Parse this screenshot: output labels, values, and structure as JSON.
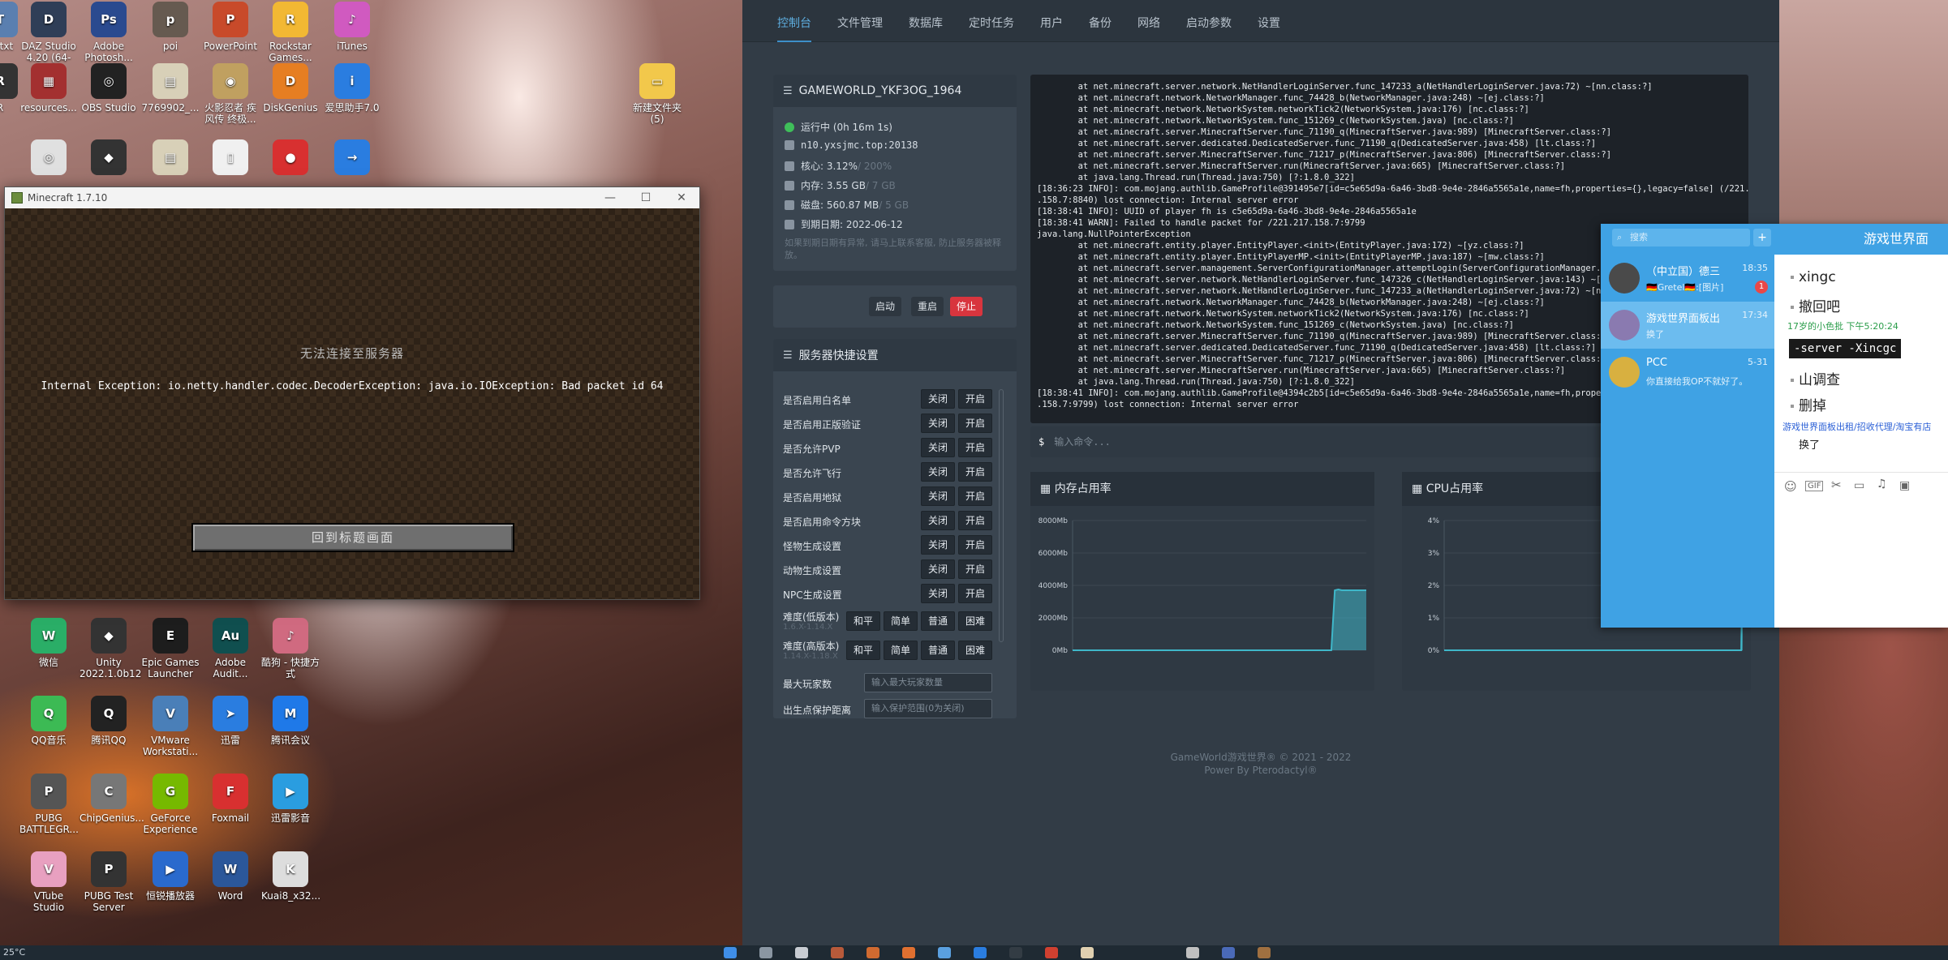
{
  "desktop": {
    "icons": [
      {
        "label": "文\ntxt",
        "x": -36,
        "y": 2,
        "color": "#5a7fb0",
        "glyph": "T"
      },
      {
        "label": "DAZ Studio 4.20 (64-bit)",
        "x": 24,
        "y": 2,
        "color": "#2f3e57",
        "glyph": "D"
      },
      {
        "label": "Adobe Photosh...",
        "x": 98,
        "y": 2,
        "color": "#2a4a8f",
        "glyph": "Ps"
      },
      {
        "label": "poi",
        "x": 174,
        "y": 2,
        "color": "#665a50",
        "glyph": "p"
      },
      {
        "label": "PowerPoint",
        "x": 248,
        "y": 2,
        "color": "#c84a2a",
        "glyph": "P"
      },
      {
        "label": "Rockstar Games...",
        "x": 322,
        "y": 2,
        "color": "#f2b833",
        "glyph": "R"
      },
      {
        "label": "iTunes",
        "x": 398,
        "y": 2,
        "color": "#d05ac0",
        "glyph": "♪"
      },
      {
        "label": "R",
        "x": -36,
        "y": 78,
        "color": "#333",
        "glyph": "R"
      },
      {
        "label": "resources...",
        "x": 24,
        "y": 78,
        "color": "#a33030",
        "glyph": "▦"
      },
      {
        "label": "OBS Studio",
        "x": 98,
        "y": 78,
        "color": "#222",
        "glyph": "◎"
      },
      {
        "label": "7769902_...",
        "x": 174,
        "y": 78,
        "color": "#d8d0b8",
        "glyph": "▤"
      },
      {
        "label": "火影忍者 疾风传 终极...",
        "x": 248,
        "y": 78,
        "color": "#c0a060",
        "glyph": "◉"
      },
      {
        "label": "DiskGenius",
        "x": 322,
        "y": 78,
        "color": "#e67e22",
        "glyph": "D"
      },
      {
        "label": "爱思助手7.0",
        "x": 398,
        "y": 78,
        "color": "#2a7de0",
        "glyph": "i"
      },
      {
        "label": "新建文件夹 (5)",
        "x": 774,
        "y": 78,
        "color": "#f2c84b",
        "glyph": "▭"
      },
      {
        "label": "",
        "x": 24,
        "y": 172,
        "color": "#e0e0e0",
        "glyph": "◎"
      },
      {
        "label": "",
        "x": 98,
        "y": 172,
        "color": "#333",
        "glyph": "◆"
      },
      {
        "label": "",
        "x": 174,
        "y": 172,
        "color": "#d8d0b8",
        "glyph": "▤"
      },
      {
        "label": "",
        "x": 248,
        "y": 172,
        "color": "#f0f0f0",
        "glyph": "▯"
      },
      {
        "label": "",
        "x": 322,
        "y": 172,
        "color": "#d83030",
        "glyph": "●"
      },
      {
        "label": "",
        "x": 398,
        "y": 172,
        "color": "#2a7de0",
        "glyph": "→"
      },
      {
        "label": "微信",
        "x": 24,
        "y": 762,
        "color": "#2aae67",
        "glyph": "W"
      },
      {
        "label": "Unity 2022.1.0b12",
        "x": 98,
        "y": 762,
        "color": "#333",
        "glyph": "◆"
      },
      {
        "label": "Epic Games Launcher",
        "x": 174,
        "y": 762,
        "color": "#1d1d1d",
        "glyph": "E"
      },
      {
        "label": "Adobe Audit...",
        "x": 248,
        "y": 762,
        "color": "#104f4f",
        "glyph": "Au"
      },
      {
        "label": "酷狗 - 快捷方式",
        "x": 322,
        "y": 762,
        "color": "#d06a80",
        "glyph": "♪"
      },
      {
        "label": "QQ音乐",
        "x": 24,
        "y": 858,
        "color": "#3cba54",
        "glyph": "Q"
      },
      {
        "label": "腾讯QQ",
        "x": 98,
        "y": 858,
        "color": "#222",
        "glyph": "Q"
      },
      {
        "label": "VMware Workstati...",
        "x": 174,
        "y": 858,
        "color": "#4a7fb8",
        "glyph": "V"
      },
      {
        "label": "迅雷",
        "x": 248,
        "y": 858,
        "color": "#2a7de0",
        "glyph": "➤"
      },
      {
        "label": "腾讯会议",
        "x": 322,
        "y": 858,
        "color": "#1f79e8",
        "glyph": "M"
      },
      {
        "label": "PUBG BATTLEGR...",
        "x": 24,
        "y": 954,
        "color": "#555",
        "glyph": "P"
      },
      {
        "label": "ChipGenius...",
        "x": 98,
        "y": 954,
        "color": "#777",
        "glyph": "C"
      },
      {
        "label": "GeForce Experience",
        "x": 174,
        "y": 954,
        "color": "#76b900",
        "glyph": "G"
      },
      {
        "label": "Foxmail",
        "x": 248,
        "y": 954,
        "color": "#d83030",
        "glyph": "F"
      },
      {
        "label": "迅雷影音",
        "x": 322,
        "y": 954,
        "color": "#2a9de0",
        "glyph": "▶"
      },
      {
        "label": "VTube Studio",
        "x": 24,
        "y": 1050,
        "color": "#e8a0c0",
        "glyph": "V"
      },
      {
        "label": "PUBG Test Server",
        "x": 98,
        "y": 1050,
        "color": "#333",
        "glyph": "P"
      },
      {
        "label": "恒锐播放器",
        "x": 174,
        "y": 1050,
        "color": "#2a6acd",
        "glyph": "▶"
      },
      {
        "label": "Word",
        "x": 248,
        "y": 1050,
        "color": "#2b579a",
        "glyph": "W"
      },
      {
        "label": "Kuai8_x32...",
        "x": 322,
        "y": 1050,
        "color": "#ddd",
        "glyph": "K"
      }
    ]
  },
  "taskbar": {
    "temperature": "25°C"
  },
  "minecraft": {
    "title": "Minecraft 1.7.10",
    "heading": "无法连接至服务器",
    "error": "Internal Exception: io.netty.handler.codec.DecoderException: java.io.IOException: Bad packet id 64",
    "back_button": "回到标题画面"
  },
  "panel": {
    "nav": [
      {
        "label": "控制台",
        "active": true
      },
      {
        "label": "文件管理"
      },
      {
        "label": "数据库"
      },
      {
        "label": "定时任务"
      },
      {
        "label": "用户"
      },
      {
        "label": "备份"
      },
      {
        "label": "网络"
      },
      {
        "label": "启动参数"
      },
      {
        "label": "设置"
      }
    ],
    "server_name": "GAMEWORLD_YKF3OG_1964",
    "status": "运行中 (0h 16m 1s)",
    "address": "n10.yxsjmc.top:20138",
    "cpu": {
      "label": "核心: 3.12%",
      "limit": " / 200%"
    },
    "memory": {
      "label": "内存: 3.55 GB",
      "limit": " / 7 GB"
    },
    "disk": {
      "label": "磁盘: 560.87 MB",
      "limit": " / 5 GB"
    },
    "expire": "到期日期: 2022-06-12",
    "notice": "如果到期日期有异常, 请马上联系客服, 防止服务器被释放。",
    "controls": {
      "start": "启动",
      "restart": "重启",
      "stop": "停止"
    },
    "settings_title": "服务器快捷设置",
    "settings": [
      {
        "label": "是否启用白名单",
        "off": "关闭",
        "on": "开启"
      },
      {
        "label": "是否启用正版验证",
        "off": "关闭",
        "on": "开启"
      },
      {
        "label": "是否允许PVP",
        "off": "关闭",
        "on": "开启"
      },
      {
        "label": "是否允许飞行",
        "off": "关闭",
        "on": "开启"
      },
      {
        "label": "是否启用地狱",
        "off": "关闭",
        "on": "开启"
      },
      {
        "label": "是否启用命令方块",
        "off": "关闭",
        "on": "开启"
      },
      {
        "label": "怪物生成设置",
        "off": "关闭",
        "on": "开启"
      },
      {
        "label": "动物生成设置",
        "off": "关闭",
        "on": "开启"
      },
      {
        "label": "NPC生成设置",
        "off": "关闭",
        "on": "开启"
      }
    ],
    "difficulty_rows": [
      {
        "label": "难度(低版本)",
        "sub": "1.6.X-1.14.X",
        "options": [
          "和平",
          "简单",
          "普通",
          "困难"
        ]
      },
      {
        "label": "难度(高版本)",
        "sub": "1.14.X-1.18.X",
        "options": [
          "和平",
          "简单",
          "普通",
          "困难"
        ]
      }
    ],
    "max_players": {
      "label": "最大玩家数",
      "placeholder": "输入最大玩家数量"
    },
    "spawn_protect": {
      "label": "出生点保护距离",
      "placeholder": "输入保护范围(0为关闭)"
    },
    "console_lines": [
      "        at net.minecraft.server.network.NetHandlerLoginServer.func_147233_a(NetHandlerLoginServer.java:72) ~[nn.class:?]",
      "        at net.minecraft.network.NetworkManager.func_74428_b(NetworkManager.java:248) ~[ej.class:?]",
      "        at net.minecraft.network.NetworkSystem.networkTick2(NetworkSystem.java:176) [nc.class:?]",
      "        at net.minecraft.network.NetworkSystem.func_151269_c(NetworkSystem.java) [nc.class:?]",
      "        at net.minecraft.server.MinecraftServer.func_71190_q(MinecraftServer.java:989) [MinecraftServer.class:?]",
      "        at net.minecraft.server.dedicated.DedicatedServer.func_71190_q(DedicatedServer.java:458) [lt.class:?]",
      "        at net.minecraft.server.MinecraftServer.func_71217_p(MinecraftServer.java:806) [MinecraftServer.class:?]",
      "        at net.minecraft.server.MinecraftServer.run(MinecraftServer.java:665) [MinecraftServer.class:?]",
      "        at java.lang.Thread.run(Thread.java:750) [?:1.8.0_322]",
      "[18:36:23 INFO]: com.mojang.authlib.GameProfile@391495e7[id=c5e65d9a-6a46-3bd8-9e4e-2846a5565a1e,name=fh,properties={},legacy=false] (/221.217",
      ".158.7:8840) lost connection: Internal server error",
      "[18:38:41 INFO]: UUID of player fh is c5e65d9a-6a46-3bd8-9e4e-2846a5565a1e",
      "[18:38:41 WARN]: Failed to handle packet for /221.217.158.7:9799",
      "java.lang.NullPointerException",
      "        at net.minecraft.entity.player.EntityPlayer.<init>(EntityPlayer.java:172) ~[yz.class:?]",
      "        at net.minecraft.entity.player.EntityPlayerMP.<init>(EntityPlayerMP.java:187) ~[mw.class:?]",
      "        at net.minecraft.server.management.ServerConfigurationManager.attemptLogin(ServerConfigurationManager.java:5",
      "        at net.minecraft.server.network.NetHandlerLoginServer.func_147326_c(NetHandlerLoginServer.java:143) ~[nn.cla",
      "        at net.minecraft.server.network.NetHandlerLoginServer.func_147233_a(NetHandlerLoginServer.java:72) ~[nn.cla",
      "        at net.minecraft.network.NetworkManager.func_74428_b(NetworkManager.java:248) ~[ej.class:?]",
      "        at net.minecraft.network.NetworkSystem.networkTick2(NetworkSystem.java:176) [nc.class:?]",
      "        at net.minecraft.network.NetworkSystem.func_151269_c(NetworkSystem.java) [nc.class:?]",
      "        at net.minecraft.server.MinecraftServer.func_71190_q(MinecraftServer.java:989) [MinecraftServer.class:?]",
      "        at net.minecraft.server.dedicated.DedicatedServer.func_71190_q(DedicatedServer.java:458) [lt.class:?]",
      "        at net.minecraft.server.MinecraftServer.func_71217_p(MinecraftServer.java:806) [MinecraftServer.class:?]",
      "        at net.minecraft.server.MinecraftServer.run(MinecraftServer.java:665) [MinecraftServer.class:?]",
      "        at java.lang.Thread.run(Thread.java:750) [?:1.8.0_322]",
      "[18:38:41 INFO]: com.mojang.authlib.GameProfile@4394c2b5[id=c5e65d9a-6a46-3bd8-9e4e-2846a5565a1e,name=fh,properties=",
      ".158.7:9799) lost connection: Internal server error"
    ],
    "command_placeholder": "输入命令...",
    "memory_chart_title": "内存占用率",
    "cpu_chart_title": "CPU占用率",
    "footer_line1": "GameWorld游戏世界® © 2021 - 2022",
    "footer_line2": "Power By Pterodactyl®"
  },
  "chart_data": [
    {
      "type": "area",
      "title": "内存占用率",
      "y_ticks": [
        "8000Mb",
        "6000Mb",
        "4000Mb",
        "2000Mb",
        "0Mb"
      ],
      "ylim": [
        0,
        8000
      ],
      "values": [
        0,
        0,
        0,
        0,
        0,
        0,
        0,
        0,
        0,
        0,
        0,
        0,
        0,
        0,
        0,
        0,
        0,
        0,
        0,
        0,
        0,
        0,
        0,
        0,
        0,
        0,
        0,
        0,
        0,
        0,
        0,
        0,
        0,
        0,
        0,
        0,
        0,
        0,
        0,
        0,
        0,
        0,
        0,
        0,
        0,
        0,
        0,
        0,
        0,
        0,
        0,
        0,
        0,
        0,
        0,
        0,
        0,
        0,
        0,
        0,
        0,
        0,
        0,
        0,
        0,
        0,
        0,
        0,
        0,
        0,
        0,
        0,
        0,
        0,
        0,
        3700,
        3750,
        3700,
        3700,
        3700,
        3700,
        3700,
        3700,
        3700,
        3700
      ],
      "color": "#3fb7c9"
    },
    {
      "type": "area",
      "title": "CPU占用率",
      "y_ticks": [
        "4%",
        "3%",
        "2%",
        "1%",
        "0%"
      ],
      "ylim": [
        0,
        4
      ],
      "values": [
        0,
        0,
        0,
        0,
        0,
        0,
        0,
        0,
        0,
        0,
        0,
        0,
        0,
        0,
        0,
        0,
        0,
        0,
        0,
        0,
        0,
        0,
        0,
        0,
        0,
        0,
        0,
        0,
        0,
        0,
        0,
        0,
        0,
        0,
        0,
        0,
        0,
        0,
        0,
        0,
        0,
        0,
        0,
        0,
        0,
        0,
        0,
        0,
        0,
        0,
        0,
        0,
        0,
        0,
        0,
        0,
        0,
        0,
        0,
        0,
        0,
        0,
        0,
        0,
        0,
        0,
        0,
        0,
        0,
        0,
        0,
        0,
        0,
        0,
        0,
        0,
        0,
        0,
        0,
        0,
        0,
        0,
        0,
        0,
        0,
        0,
        0,
        0,
        0,
        0,
        0,
        0,
        0,
        0,
        0,
        0,
        0,
        0,
        0,
        0,
        0,
        0,
        0,
        0,
        0,
        0,
        0,
        0,
        0,
        0,
        0,
        0,
        0,
        0,
        0,
        0,
        0,
        0,
        0,
        0,
        0,
        0,
        0,
        0,
        0,
        0,
        0,
        0,
        0,
        0,
        0,
        0,
        0,
        0,
        0,
        0,
        0,
        0,
        0,
        0,
        0,
        0,
        0,
        0,
        0,
        0,
        0,
        0,
        0,
        0,
        0,
        0,
        0,
        0,
        0,
        0,
        0,
        0,
        0,
        0,
        0,
        0,
        0,
        0,
        0,
        0,
        0,
        0,
        0,
        0,
        0,
        0,
        0,
        0,
        0,
        0,
        0,
        0,
        0,
        0,
        0,
        0,
        0,
        0,
        0,
        0,
        0,
        0,
        0,
        0,
        0,
        0,
        0,
        0,
        0,
        0,
        0,
        0,
        3.1
      ],
      "color": "#3fb7c9"
    }
  ],
  "qq": {
    "search_placeholder": "搜索",
    "add": "+",
    "conversations": [
      {
        "name": "（中立国）德三",
        "msg": "🇩🇪Gretel🇩🇪:[图片]",
        "time": "18:35",
        "badge": "1",
        "avatar": "#4a4a4a"
      },
      {
        "name": "游戏世界面板出",
        "msg": "换了",
        "time": "17:34",
        "avatar": "#8a7ab0"
      },
      {
        "name": "PCC",
        "msg": "你直接给我OP不就好了。",
        "time": "5-31",
        "avatar": "#d8b040"
      }
    ],
    "chat_title": "游戏世界面",
    "messages": {
      "m1": "xingc",
      "m2": "撤回吧",
      "sender": "17岁的小色批  下午5:20:24",
      "code": " -server -Xincgc ",
      "m3": "山调查",
      "m4": "删掉",
      "sender2": "游戏世界面板出租/招收代理/淘宝有店",
      "m5": "换了"
    }
  }
}
